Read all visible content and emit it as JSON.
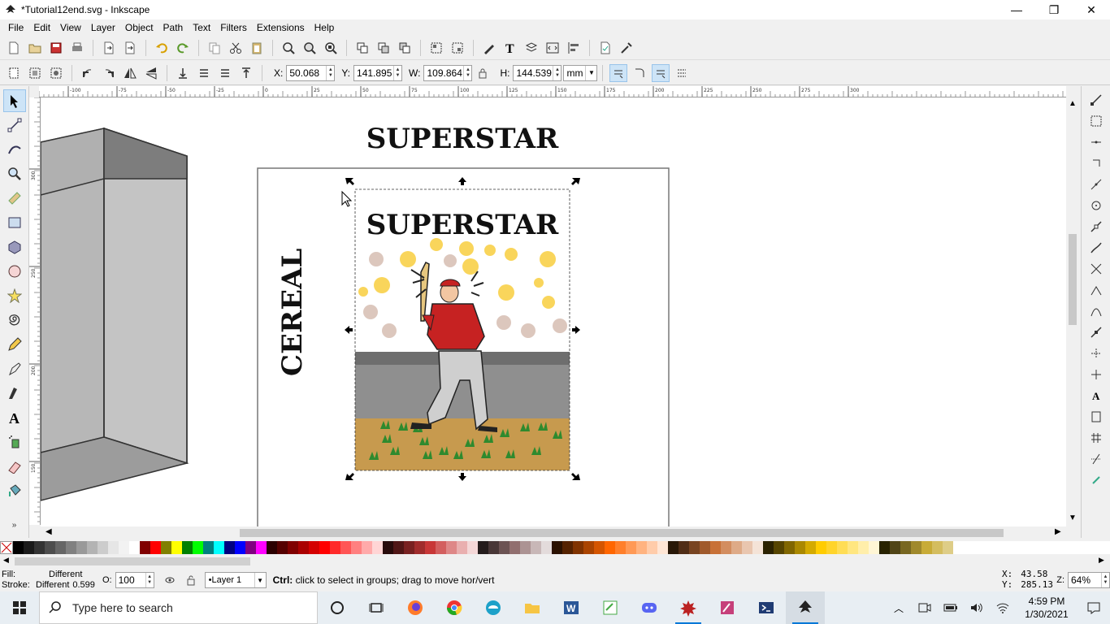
{
  "window": {
    "title": "*Tutorial12end.svg - Inkscape",
    "minimize": "—",
    "restore": "❐",
    "close": "✕"
  },
  "menu": [
    "File",
    "Edit",
    "View",
    "Layer",
    "Object",
    "Path",
    "Text",
    "Filters",
    "Extensions",
    "Help"
  ],
  "controls": {
    "x_label": "X:",
    "x_value": "50.068",
    "y_label": "Y:",
    "y_value": "141.895",
    "w_label": "W:",
    "w_value": "109.864",
    "h_label": "H:",
    "h_value": "144.539",
    "unit": "mm"
  },
  "canvas": {
    "title_text": "SUPERSTAR",
    "inner_title_text": "SUPERSTAR",
    "side_text": "CEREAL"
  },
  "ruler": {
    "h_ticks": [
      "-100",
      "-75",
      "-50",
      "-25",
      "0",
      "25",
      "50",
      "75",
      "100",
      "125",
      "150",
      "175",
      "200",
      "225",
      "250",
      "275",
      "300"
    ],
    "v_ticks": [
      "300",
      "250",
      "200",
      "150"
    ]
  },
  "status": {
    "fill_label": "Fill:",
    "fill_value": "Different",
    "stroke_label": "Stroke:",
    "stroke_value": "Different",
    "stroke_width": "0.599",
    "opacity_label": "O:",
    "opacity_value": "100",
    "layer": "•Layer 1",
    "message_key": "Ctrl:",
    "message": " click to select in groups; drag to move hor/vert",
    "x_label": "X:",
    "x_value": "43.58",
    "y_label": "Y:",
    "y_value": "285.13",
    "zoom_label": "Z:",
    "zoom_value": "64%"
  },
  "taskbar": {
    "search_placeholder": "Type here to search",
    "time": "4:59 PM",
    "date": "1/30/2021"
  },
  "palette_colors": [
    "#000000",
    "#1a1a1a",
    "#333333",
    "#4d4d4d",
    "#666666",
    "#808080",
    "#999999",
    "#b3b3b3",
    "#cccccc",
    "#e6e6e6",
    "#f2f2f2",
    "#ffffff",
    "#800000",
    "#ff0000",
    "#808000",
    "#ffff00",
    "#008000",
    "#00ff00",
    "#008080",
    "#00ffff",
    "#000080",
    "#0000ff",
    "#800080",
    "#ff00ff",
    "#2b0000",
    "#550000",
    "#800000",
    "#aa0000",
    "#d40000",
    "#ff0000",
    "#ff2a2a",
    "#ff5555",
    "#ff8080",
    "#ffaaaa",
    "#ffd5d5",
    "#280b0b",
    "#501616",
    "#782121",
    "#a02c2c",
    "#c83737",
    "#d35f5f",
    "#de8787",
    "#e9afaf",
    "#f4d7d7",
    "#241c1c",
    "#483737",
    "#6c5353",
    "#916f6f",
    "#ac9393",
    "#c8b7b7",
    "#e3dbdb",
    "#2b1100",
    "#552200",
    "#803300",
    "#aa4400",
    "#d45500",
    "#ff6600",
    "#ff7f2a",
    "#ff9955",
    "#ffb380",
    "#ffccaa",
    "#ffe6d5",
    "#281707",
    "#502d16",
    "#784421",
    "#a05a2c",
    "#c87137",
    "#d38d5f",
    "#deaa87",
    "#e9c6af",
    "#f4e3d7",
    "#2b2200",
    "#554400",
    "#806600",
    "#aa8800",
    "#d4aa00",
    "#ffcc00",
    "#ffd42a",
    "#ffdd55",
    "#ffe680",
    "#ffeeaa",
    "#fff6d5",
    "#282200",
    "#504416",
    "#786721",
    "#a0892c",
    "#c8ab37",
    "#d4bd5f",
    "#decd87"
  ]
}
